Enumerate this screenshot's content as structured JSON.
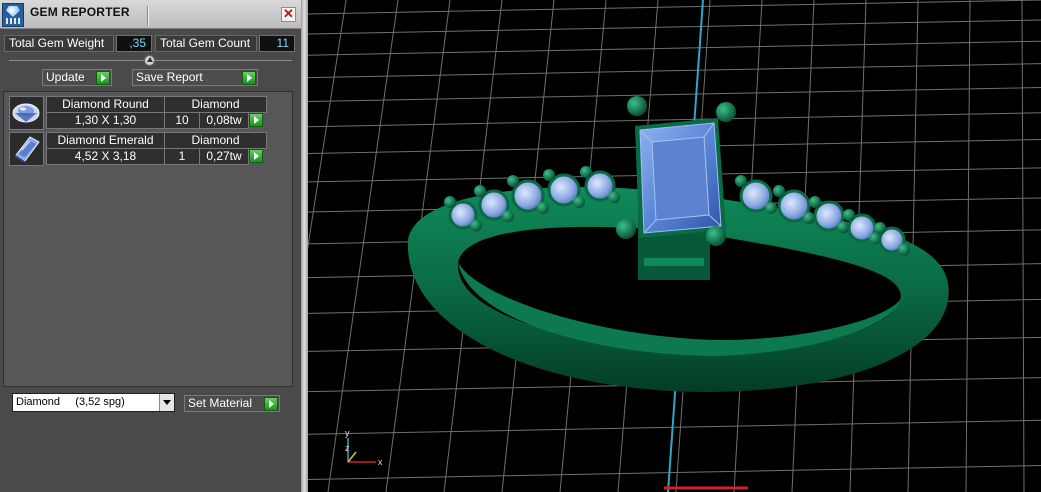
{
  "window": {
    "title": "GEM REPORTER",
    "close_glyph": "✕"
  },
  "stats": {
    "total_weight_label": "Total Gem Weight",
    "total_weight_value": ",35",
    "total_count_label": "Total Gem Count",
    "total_count_value": "11"
  },
  "toolbar": {
    "update_label": "Update",
    "save_report_label": "Save Report"
  },
  "gems": [
    {
      "name": "Diamond Round",
      "material": "Diamond",
      "size": "1,30 X 1,30",
      "count": "10",
      "weight": "0,08tw",
      "shape_icon": "round-gem-icon"
    },
    {
      "name": "Diamond Emerald",
      "material": "Diamond",
      "size": "4,52 X 3,18",
      "count": "1",
      "weight": "0,27tw",
      "shape_icon": "emerald-cut-gem-icon"
    }
  ],
  "material": {
    "selected": "Diamond     (3,52 spg)",
    "set_material_label": "Set Material"
  },
  "viewport": {
    "axis_labels": {
      "x": "x",
      "y": "y",
      "z": "z"
    },
    "colors": {
      "metal": "#0b6b45",
      "gem": "#5b86d6",
      "grid": "#6f6f6f",
      "y_axis": "#2fa7c9",
      "x_axis": "#d32222"
    }
  }
}
